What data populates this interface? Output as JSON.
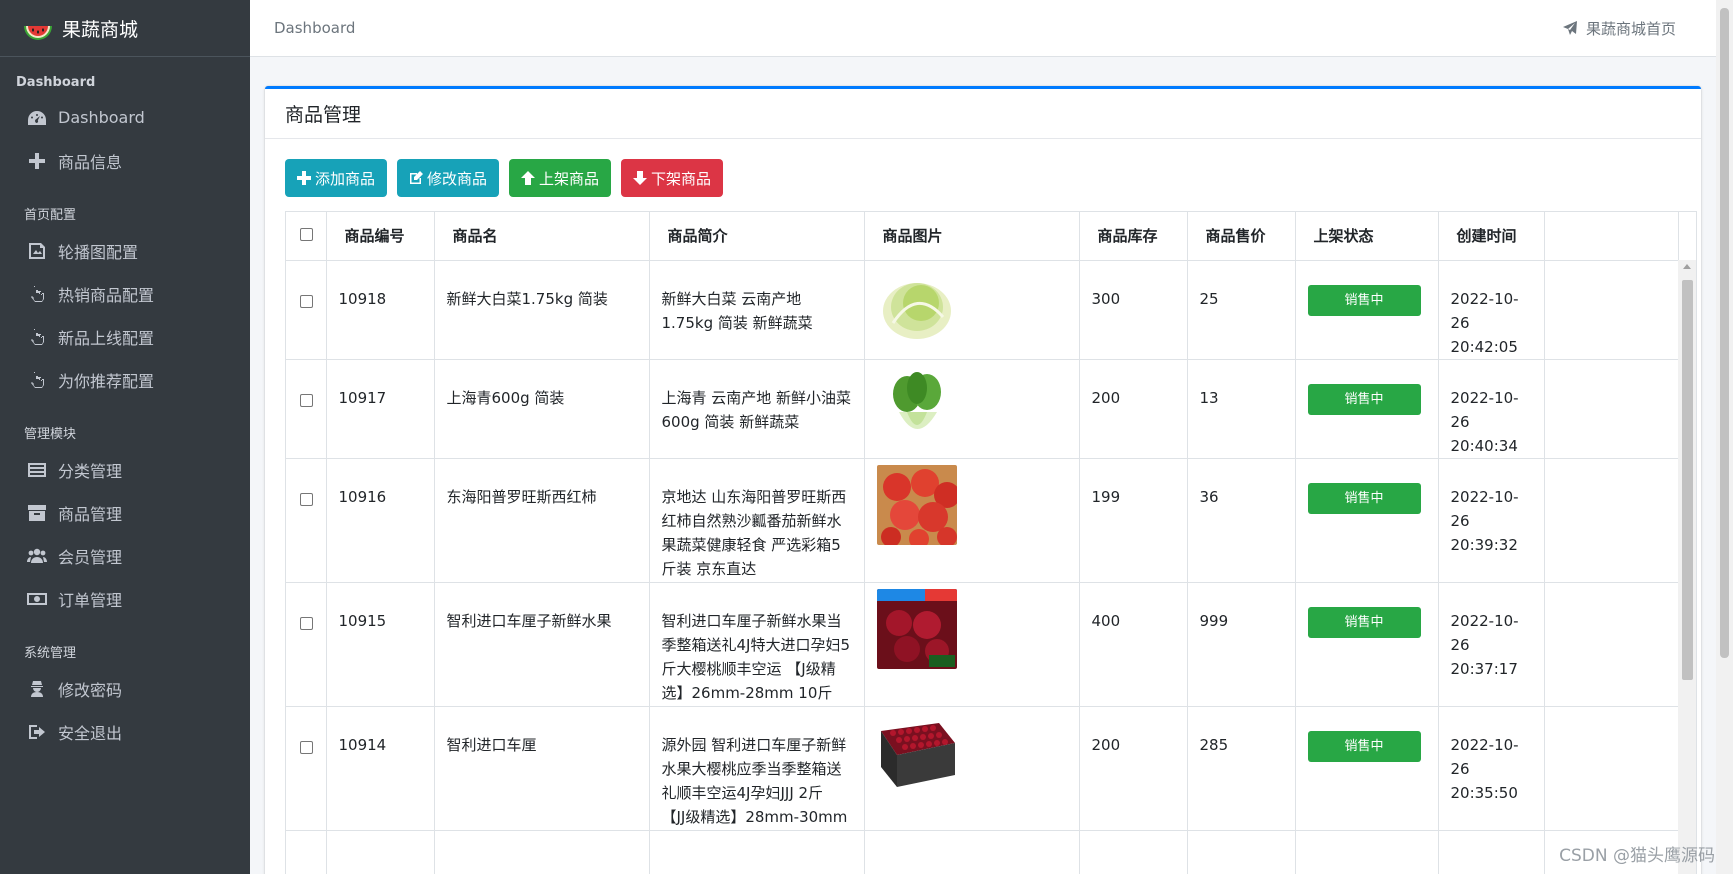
{
  "brand": {
    "title": "果蔬商城",
    "logo_icon": "watermelon-icon"
  },
  "sidebar": {
    "header_main": "Dashboard",
    "items_main": [
      {
        "label": "Dashboard",
        "icon": "dashboard-icon"
      },
      {
        "label": "商品信息",
        "icon": "plus-icon"
      }
    ],
    "header_home": "首页配置",
    "items_home": [
      {
        "label": "轮播图配置",
        "icon": "image-icon"
      },
      {
        "label": "热销商品配置",
        "icon": "hand-pointer-icon"
      },
      {
        "label": "新品上线配置",
        "icon": "hand-pointer-icon"
      },
      {
        "label": "为你推荐配置",
        "icon": "hand-pointer-icon"
      }
    ],
    "header_manage": "管理模块",
    "items_manage": [
      {
        "label": "分类管理",
        "icon": "list-icon"
      },
      {
        "label": "商品管理",
        "icon": "archive-icon"
      },
      {
        "label": "会员管理",
        "icon": "users-icon"
      },
      {
        "label": "订单管理",
        "icon": "money-icon"
      }
    ],
    "header_system": "系统管理",
    "items_system": [
      {
        "label": "修改密码",
        "icon": "user-secret-icon"
      },
      {
        "label": "安全退出",
        "icon": "sign-out-icon"
      }
    ]
  },
  "topbar": {
    "breadcrumb": "Dashboard",
    "home_link": "果蔬商城首页"
  },
  "card": {
    "title": "商品管理",
    "buttons": {
      "add": "添加商品",
      "edit": "修改商品",
      "up": "上架商品",
      "down": "下架商品"
    }
  },
  "table": {
    "headers": [
      "商品编号",
      "商品名",
      "商品简介",
      "商品图片",
      "商品库存",
      "商品售价",
      "上架状态",
      "创建时间"
    ],
    "rows": [
      {
        "id": "10918",
        "name": "新鲜大白菜1.75kg 简装",
        "intro": "新鲜大白菜 云南产地 1.75kg 简装 新鲜蔬菜",
        "image": "cabbage",
        "stock": "300",
        "price": "25",
        "status": "销售中",
        "created": "2022-10-26 20:42:05"
      },
      {
        "id": "10917",
        "name": "上海青600g 简装",
        "intro": "上海青 云南产地 新鲜小油菜 600g 简装 新鲜蔬菜",
        "image": "bokchoy",
        "stock": "200",
        "price": "13",
        "status": "销售中",
        "created": "2022-10-26 20:40:34"
      },
      {
        "id": "10916",
        "name": "东海阳普罗旺斯西红柿",
        "intro": "京地达 山东海阳普罗旺斯西红柿自然熟沙瓤番茄新鲜水果蔬菜健康轻食 严选彩箱5斤装 京东直达",
        "image": "tomato",
        "stock": "199",
        "price": "36",
        "status": "销售中",
        "created": "2022-10-26 20:39:32"
      },
      {
        "id": "10915",
        "name": "智利进口车厘子新鲜水果",
        "intro": "智利进口车厘子新鲜水果当季整箱送礼4J特大进口孕妇5斤大樱桃顺丰空运 【J级精选】26mm-28mm 10斤",
        "image": "cherry",
        "stock": "400",
        "price": "999",
        "status": "销售中",
        "created": "2022-10-26 20:37:17"
      },
      {
        "id": "10914",
        "name": "智利进口车厘",
        "intro": "源外园 智利进口车厘子新鲜水果大樱桃应季当季整箱送礼顺丰空运4J孕妇JJJ 2斤 【JJ级精选】28mm-30mm",
        "image": "cherrybox",
        "stock": "200",
        "price": "285",
        "status": "销售中",
        "created": "2022-10-26 20:35:50"
      }
    ]
  },
  "watermark": "CSDN @猫头鹰源码"
}
